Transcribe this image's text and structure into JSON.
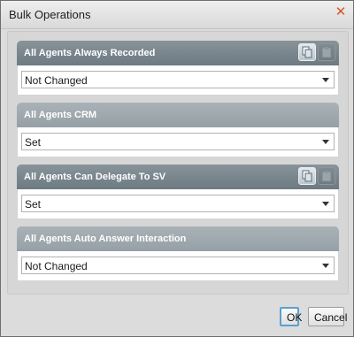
{
  "dialog": {
    "title": "Bulk Operations",
    "close_label": "✕"
  },
  "groups": [
    {
      "title": "All Agents Always Recorded",
      "value": "Not Changed",
      "has_actions": true
    },
    {
      "title": "All Agents CRM",
      "value": "Set",
      "has_actions": false
    },
    {
      "title": "All Agents Can Delegate To SV",
      "value": "Set",
      "has_actions": true
    },
    {
      "title": "All Agents Auto Answer Interaction",
      "value": "Not Changed",
      "has_actions": false
    }
  ],
  "icons": {
    "copy": "copy-icon",
    "paste": "paste-icon",
    "dropdown": "chevron-down-icon"
  },
  "footer": {
    "ok_label": "OK",
    "cancel_label": "Cancel"
  },
  "colors": {
    "header_dark": "#6d7a82",
    "header_light": "#95a0a6",
    "close": "#d8552a",
    "focus_ring": "#5aa0d0"
  }
}
